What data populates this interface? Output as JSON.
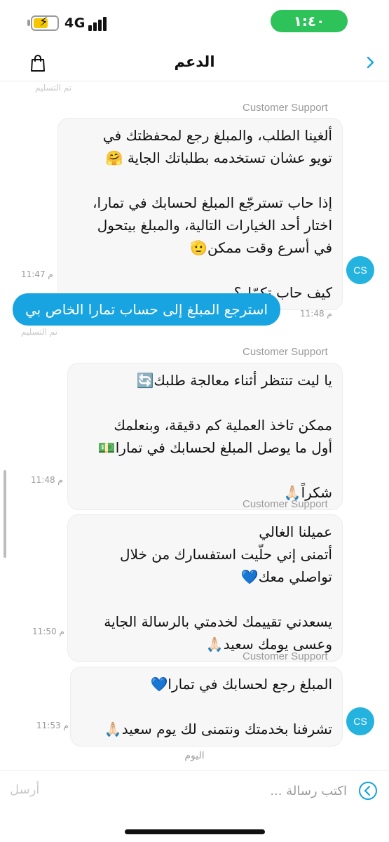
{
  "status_bar": {
    "network": "4G",
    "time": "١:٤٠"
  },
  "header": {
    "title": "الدعم"
  },
  "delivered_label": "تم التسليم",
  "sender_name": "Customer Support",
  "avatar_initials": "CS",
  "messages": [
    {
      "lines": [
        "ألغينا الطلب، والمبلغ رجع لمحفظتك في",
        "تويو عشان تستخدمه بطلباتك الجاية 🤗",
        "",
        "إذا حاب تسترجّع المبلغ لحسابك في تمارا،",
        "اختار أحد الخيارات التالية، والمبلغ بيتحول",
        "في أسرع وقت ممكن🫡",
        "",
        "كيف حاب تكمّل؟"
      ],
      "time": "11:47 م"
    },
    {
      "text": "استرجع المبلغ إلى حساب تمارا الخاص بي",
      "time": "11:48 م"
    },
    {
      "lines": [
        "يا ليت تنتظر أثناء معالجة طلبك🔄",
        "",
        "ممكن تاخذ العملية كم دقيقة، وبنعلمك",
        "أول ما يوصل المبلغ لحسابك في تمارا💵",
        "",
        "شكراً🙏🏻"
      ],
      "time": "11:48 م"
    },
    {
      "lines": [
        "عميلنا الغالي",
        "أتمنى إني حلّيت استفسارك من خلال",
        "تواصلي معك💙",
        "",
        "يسعدني تقييمك لخدمتي بالرسالة الجاية",
        "وعسى يومك سعيد🙏🏻"
      ],
      "time": "11:50 م"
    },
    {
      "lines": [
        "المبلغ رجع لحسابك في تمارا💙",
        "",
        "تشرفنا بخدمتك ونتمنى لك يوم سعيد🙏🏻"
      ],
      "time": "11:53 م"
    }
  ],
  "day_label": "اليوم",
  "input": {
    "placeholder": "اكتب رسالة ...",
    "send_label": "أرسل"
  },
  "colors": {
    "accent": "#18a4e0",
    "avatar": "#24b3df",
    "status_pill": "#2ec25a"
  }
}
